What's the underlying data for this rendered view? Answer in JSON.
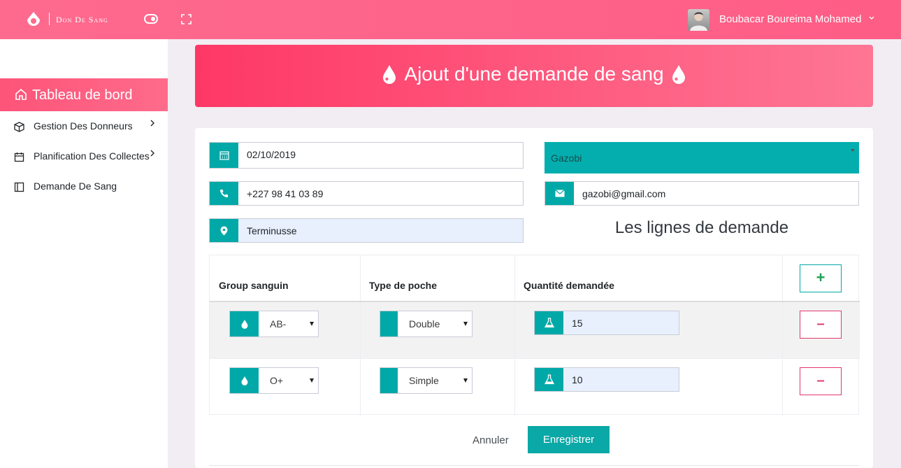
{
  "topbar": {
    "brand": "Don De Sang",
    "user_name": "Boubacar Boureima Mohamed",
    "icons": [
      "logo-drop-icon",
      "toggle-sidebar-icon",
      "fullscreen-icon",
      "chevron-down-icon"
    ]
  },
  "sidebar": {
    "active": {
      "label": "Tableau de bord",
      "icon": "home-icon"
    },
    "items": [
      {
        "label": "Gestion Des Donneurs",
        "icon": "box-icon"
      },
      {
        "label": "Planification Des Collectes",
        "icon": "calendar-icon"
      },
      {
        "label": "Demande De Sang",
        "icon": "layout-icon"
      }
    ]
  },
  "header": {
    "title": "Ajout d'une demande de sang"
  },
  "form": {
    "date": "02/10/2019",
    "phone": "+227 98 41 03 89",
    "location": "Terminusse",
    "hospital": "Gazobi",
    "email": "gazobi@gmail.com"
  },
  "lines": {
    "title": "Les lignes de demande",
    "headers": {
      "group": "Group sanguin",
      "type": "Type de poche",
      "qty": "Quantité demandée"
    },
    "add_label": "+",
    "remove_label": "–",
    "rows": [
      {
        "group": "AB-",
        "type": "Double",
        "qty": "15"
      },
      {
        "group": "O+",
        "type": "Simple",
        "qty": "10"
      }
    ]
  },
  "actions": {
    "cancel": "Annuler",
    "save": "Enregistrer"
  },
  "colors": {
    "primary": "#fe6a8e",
    "teal": "#00a9a7",
    "danger": "#e2386c"
  }
}
